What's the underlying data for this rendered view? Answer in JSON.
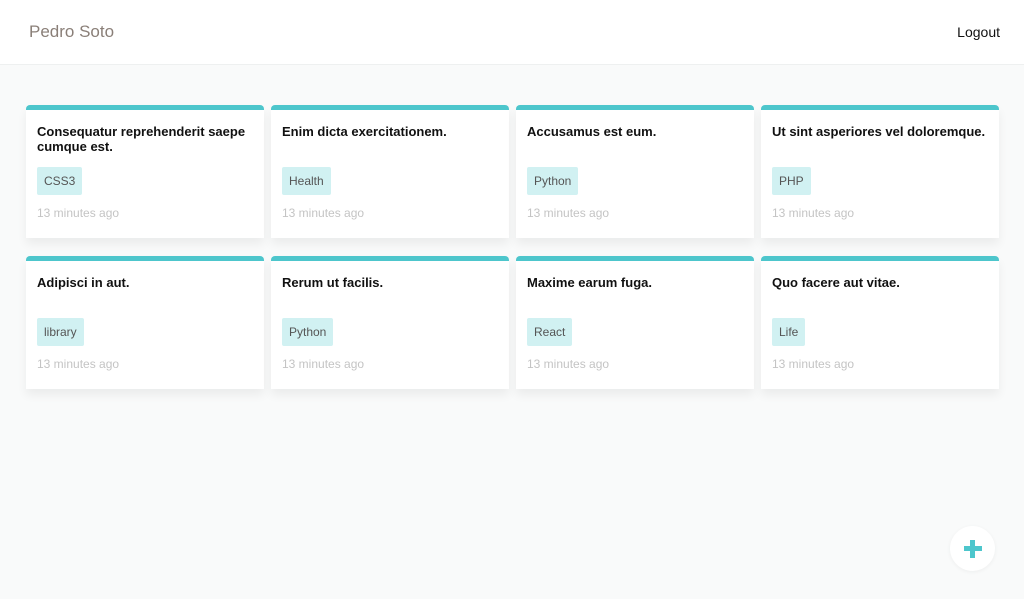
{
  "header": {
    "brand": "Pedro Soto",
    "logout": "Logout"
  },
  "accent": "#4dc6cc",
  "fab": {
    "icon": "plus-icon"
  },
  "cards": [
    {
      "title": "Consequatur reprehenderit saepe cumque est.",
      "tag": "CSS3",
      "time": "13 minutes ago"
    },
    {
      "title": "Enim dicta exercitationem.",
      "tag": "Health",
      "time": "13 minutes ago"
    },
    {
      "title": "Accusamus est eum.",
      "tag": "Python",
      "time": "13 minutes ago"
    },
    {
      "title": "Ut sint asperiores vel doloremque.",
      "tag": "PHP",
      "time": "13 minutes ago"
    },
    {
      "title": "Adipisci in aut.",
      "tag": "library",
      "time": "13 minutes ago"
    },
    {
      "title": "Rerum ut facilis.",
      "tag": "Python",
      "time": "13 minutes ago"
    },
    {
      "title": "Maxime earum fuga.",
      "tag": "React",
      "time": "13 minutes ago"
    },
    {
      "title": "Quo facere aut vitae.",
      "tag": "Life",
      "time": "13 minutes ago"
    }
  ]
}
